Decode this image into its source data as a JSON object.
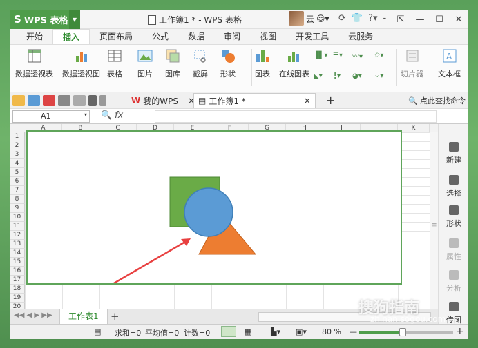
{
  "app": {
    "logo": "S",
    "name": "WPS 表格",
    "dropdown": "▼"
  },
  "title": {
    "text": "工作簿1 * - WPS 表格"
  },
  "user": {
    "name": "云"
  },
  "menu": {
    "tabs": [
      "开始",
      "插入",
      "页面布局",
      "公式",
      "数据",
      "审阅",
      "视图",
      "开发工具",
      "云服务"
    ],
    "active": "插入"
  },
  "ribbon": {
    "pivot_table": "数据透视表",
    "pivot_chart": "数据透视图",
    "table": "表格",
    "picture": "图片",
    "gallery": "图库",
    "screenshot": "截屏",
    "shape": "形状",
    "chart": "图表",
    "online_chart": "在线图表",
    "slicer": "切片器",
    "textbox": "文本框"
  },
  "doc_tabs": {
    "wps": "我的WPS",
    "workbook": "工作簿1 *"
  },
  "search_cmd": "点此查找命令",
  "formula_bar": {
    "cell_ref": "A1",
    "fx": "fx"
  },
  "columns": [
    "A",
    "B",
    "C",
    "D",
    "E",
    "F",
    "G",
    "H",
    "I",
    "J",
    "K"
  ],
  "rows": [
    "1",
    "2",
    "3",
    "4",
    "5",
    "6",
    "7",
    "8",
    "9",
    "10",
    "11",
    "12",
    "13",
    "14",
    "15",
    "16",
    "17",
    "18",
    "19",
    "20"
  ],
  "right_pane": {
    "new": "新建",
    "select": "选择",
    "shape": "形状",
    "properties": "属性",
    "analyze": "分析",
    "legend": "传图"
  },
  "sheet_tabs": {
    "sheet1": "工作表1",
    "add": "+"
  },
  "status": {
    "sum": "求和=0",
    "average": "平均值=0",
    "count": "计数=0",
    "zoom": "80 %",
    "zoom_level": 0.46
  },
  "watermark": {
    "brand": "搜狗指南",
    "url": "zhinan.sogou.com"
  },
  "colors": {
    "accent": "#4f9d4a",
    "square": "#6aab47",
    "circle": "#5b9bd5",
    "triangle": "#ed7d31",
    "arrow": "#e84040"
  }
}
